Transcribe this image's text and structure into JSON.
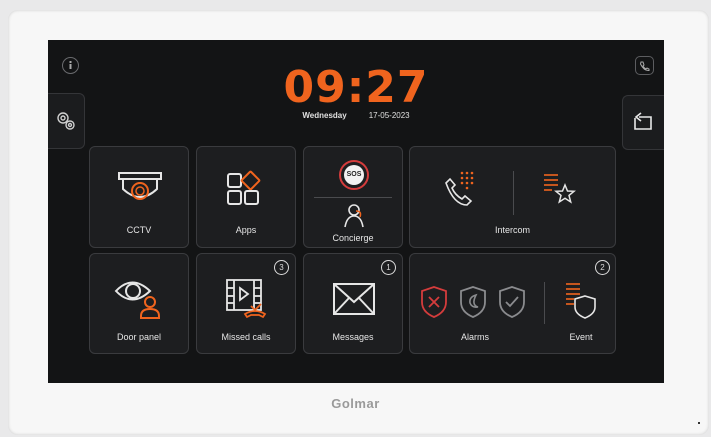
{
  "colors": {
    "accent": "#f0641e",
    "alarm_red": "#d43c3c",
    "screen_bg": "#131415"
  },
  "header": {
    "time": "09:27",
    "day": "Wednesday",
    "date": "17-05-2023"
  },
  "side_buttons": {
    "info": "info-icon",
    "settings": "gear-icon",
    "phone_status": "handset-icon",
    "back": "back-icon"
  },
  "tiles": {
    "cctv": {
      "label": "CCTV"
    },
    "apps": {
      "label": "Apps"
    },
    "sos": {
      "label": "SOS"
    },
    "concierge": {
      "label": "Concierge"
    },
    "intercom": {
      "label": "Intercom"
    },
    "door_panel": {
      "label": "Door panel"
    },
    "missed_calls": {
      "label": "Missed calls",
      "badge": "3"
    },
    "messages": {
      "label": "Messages",
      "badge": "1"
    },
    "alarms": {
      "label": "Alarms"
    },
    "event": {
      "label": "Event",
      "badge": "2"
    }
  },
  "brand": "Golmar"
}
